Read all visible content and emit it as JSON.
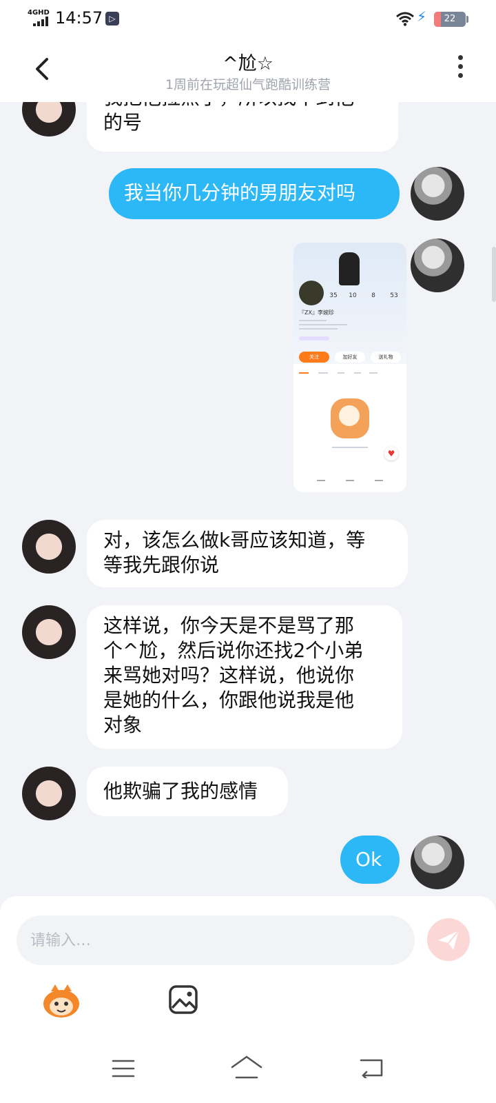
{
  "status_bar": {
    "network": "4GHD",
    "time": "14:57",
    "battery": "22",
    "battery_level_percent": 22,
    "app_icon": "play-app-icon"
  },
  "header": {
    "title": "^尬☆",
    "subtitle": "1周前在玩超仙气跑酷训练营",
    "back_icon": "chevron-left-icon",
    "more_icon": "more-vertical-icon"
  },
  "messages": [
    {
      "side": "left",
      "avatar": "avatar-female",
      "lines": [
        "我把他拉黑了，所以找不到他",
        "的号"
      ]
    },
    {
      "side": "right",
      "avatar": "avatar-male",
      "lines": [
        "我当你几分钟的男朋友对吗"
      ]
    },
    {
      "side": "right",
      "avatar": "avatar-male",
      "type": "image",
      "image_text": {
        "stats": [
          "35",
          "10",
          "8",
          "53"
        ],
        "name": "『ZX』李婉珍",
        "follow": "关注",
        "add_friend": "加好友",
        "gift": "送礼物"
      }
    },
    {
      "side": "left",
      "avatar": "avatar-female",
      "lines": [
        "对，该怎么做k哥应该知道，等",
        "等我先跟你说"
      ]
    },
    {
      "side": "left",
      "avatar": "avatar-female",
      "lines": [
        "这样说，你今天是不是骂了那",
        "个^尬，然后说你还找2个小弟",
        "来骂她对吗？这样说，他说你",
        "是她的什么，你跟他说我是他",
        "对象"
      ]
    },
    {
      "side": "left",
      "avatar": "avatar-female",
      "lines": [
        "他欺骗了我的感情"
      ]
    },
    {
      "side": "right",
      "avatar": "avatar-male",
      "lines": [
        "Ok"
      ]
    }
  ],
  "composer": {
    "placeholder": "请输入…",
    "send_icon": "send-icon",
    "tools": [
      "emoji-mascot-icon",
      "image-icon"
    ]
  },
  "nav_bar": {
    "icons": [
      "menu-icon",
      "home-icon",
      "back-icon"
    ]
  },
  "colors": {
    "background": "#f1f3f7",
    "bubble_right": "#2cb8f6",
    "bubble_left": "#ffffff",
    "send_button": "#fbd8d6"
  }
}
